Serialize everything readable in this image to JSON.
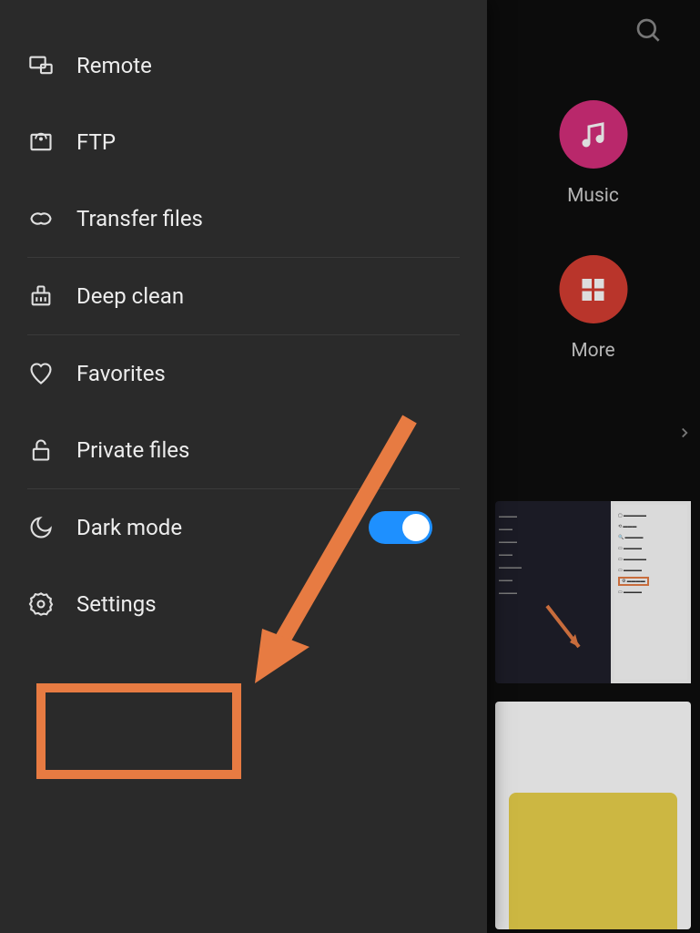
{
  "drawer": {
    "items": [
      {
        "icon": "remote",
        "label": "Remote"
      },
      {
        "icon": "ftp",
        "label": "FTP"
      },
      {
        "icon": "transfer",
        "label": "Transfer files"
      },
      {
        "icon": "clean",
        "label": "Deep clean"
      },
      {
        "icon": "heart",
        "label": "Favorites"
      },
      {
        "icon": "lock",
        "label": "Private files"
      },
      {
        "icon": "moon",
        "label": "Dark mode",
        "toggle": true,
        "toggle_on": true
      },
      {
        "icon": "settings",
        "label": "Settings"
      }
    ]
  },
  "backdrop": {
    "music_label": "Music",
    "more_label": "More"
  },
  "annotation": {
    "highlighted_item": "Settings",
    "arrow_color": "#e77b42"
  }
}
